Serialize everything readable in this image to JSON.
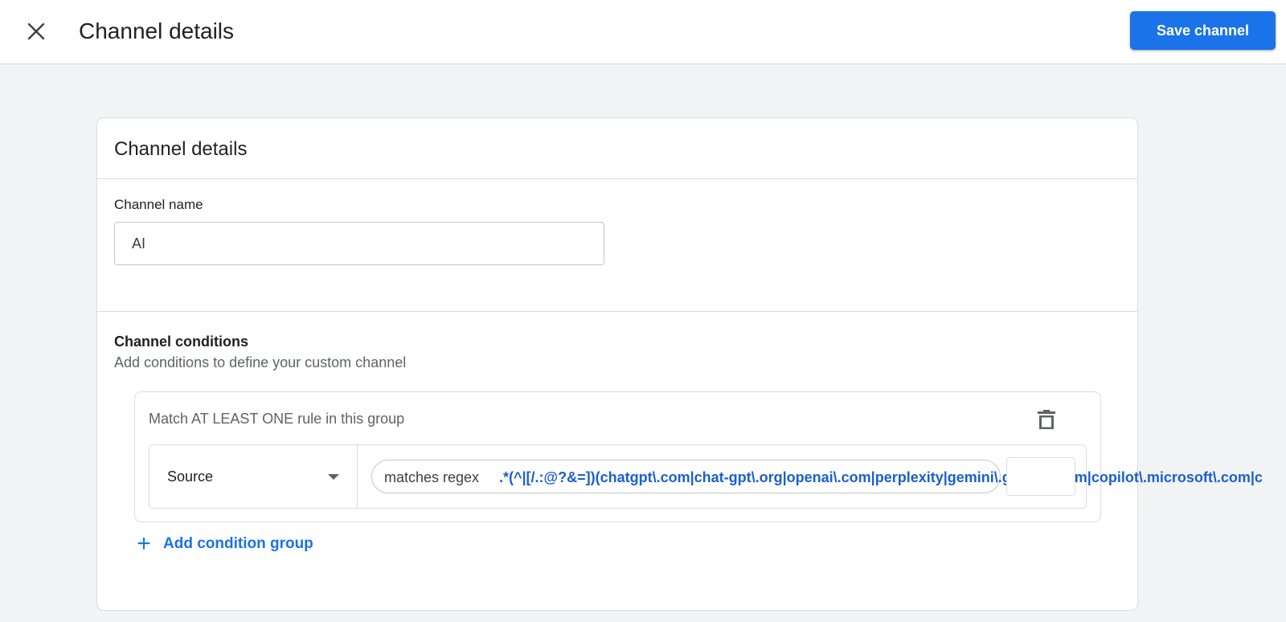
{
  "header": {
    "title": "Channel details",
    "save_label": "Save channel",
    "close_icon": "close-icon"
  },
  "card": {
    "title": "Channel details",
    "channel_name": {
      "label": "Channel name",
      "value": "AI"
    },
    "conditions": {
      "title": "Channel conditions",
      "subtitle": "Add conditions to define your custom channel",
      "groups": [
        {
          "label": "Match AT LEAST ONE rule in this group",
          "rules": [
            {
              "dimension": "Source",
              "operator": "matches regex",
              "value": ".*(^|[/.:@?&=])(chatgpt\\.com|chat-gpt\\.org|openai\\.com|perplexity|gemini\\.google\\.com|copilot\\.microsoft\\.com|c"
            }
          ]
        }
      ],
      "add_group_label": "Add condition group"
    }
  },
  "colors": {
    "primary": "#1a73e8",
    "regex_text": "#1a5fd0",
    "background": "#f1f3f4",
    "border": "#dadce0"
  }
}
